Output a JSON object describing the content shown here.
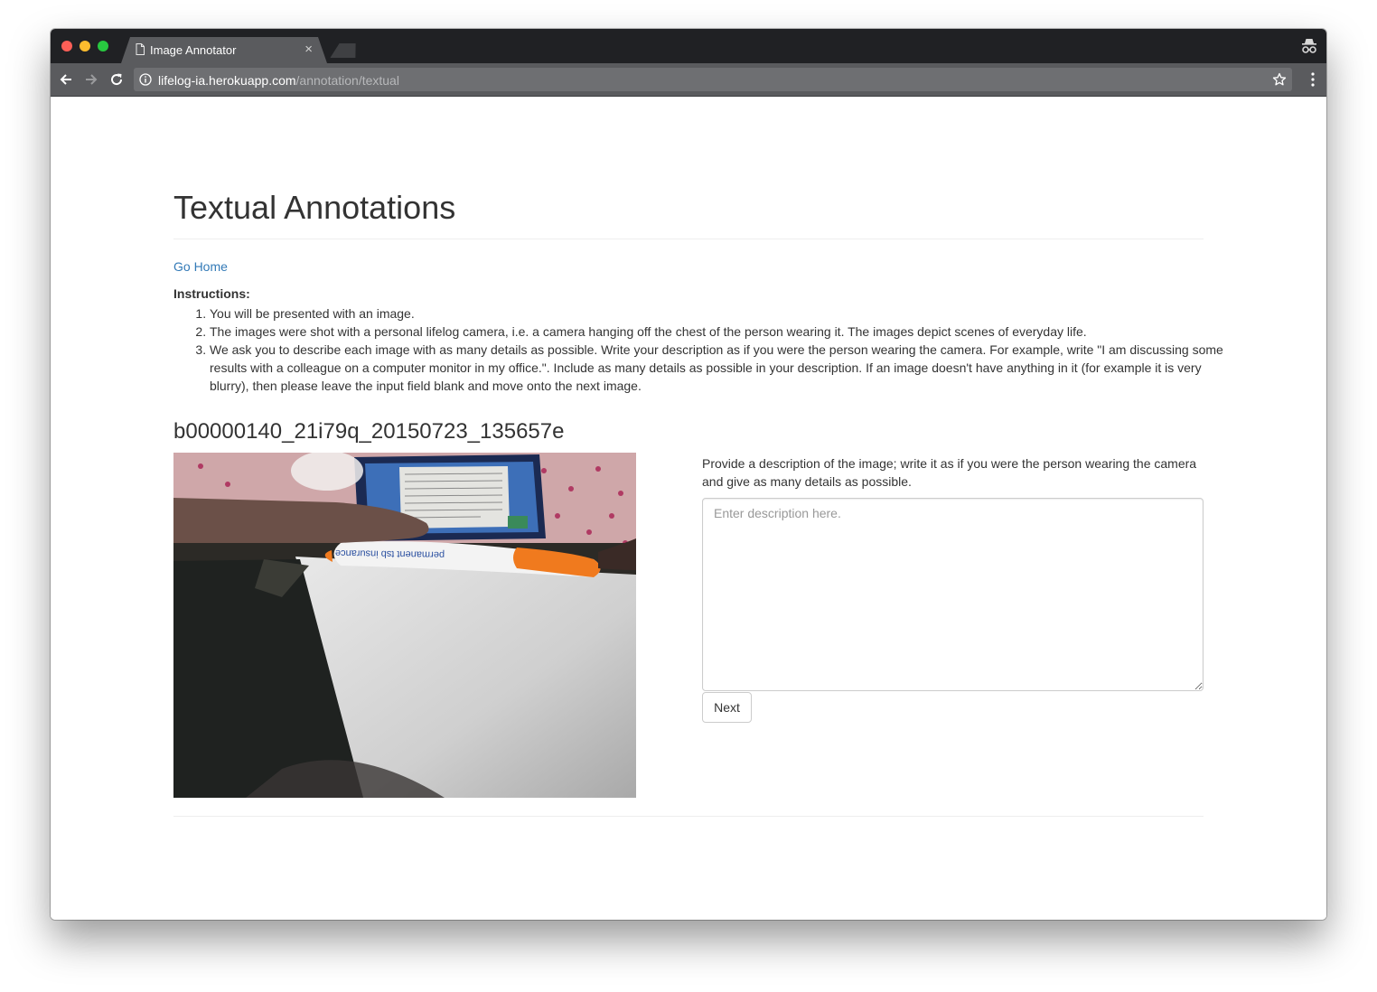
{
  "browser": {
    "tab_title": "Image Annotator",
    "tab_close": "×",
    "url_host": "lifelog-ia.herokuapp.com",
    "url_path": "/annotation/textual"
  },
  "page": {
    "title": "Textual Annotations",
    "go_home": "Go Home",
    "instructions_label": "Instructions:",
    "instructions": [
      "You will be presented with an image.",
      "The images were shot with a personal lifelog camera, i.e. a camera hanging off the chest of the person wearing it. The images depict scenes of everyday life.",
      "We ask you to describe each image with as many details as possible. Write your description as if you were the person wearing the camera. For example, write \"I am discussing some results with a colleague on a computer monitor in my office.\". Include as many details as possible in your description. If an image doesn't have anything in it (for example it is very blurry), then please leave the input field blank and move onto the next image."
    ],
    "image_id": "b00000140_21i79q_20150723_135657e",
    "description_prompt": "Provide a description of the image; write it as if you were the person wearing the camera and give as many details as possible.",
    "description_placeholder": "Enter description here.",
    "description_value": "",
    "next_label": "Next"
  },
  "icons": {
    "tab": "page-icon",
    "back": "back-arrow-icon",
    "forward": "forward-arrow-icon",
    "reload": "reload-icon",
    "info": "info-icon",
    "star": "star-icon",
    "menu": "menu-icon",
    "incognito": "incognito-icon"
  },
  "colors": {
    "link": "#337ab7",
    "text": "#333333",
    "tabbar": "#202124",
    "toolbar": "#5a5b5e",
    "pen_orange": "#f07a1e"
  }
}
